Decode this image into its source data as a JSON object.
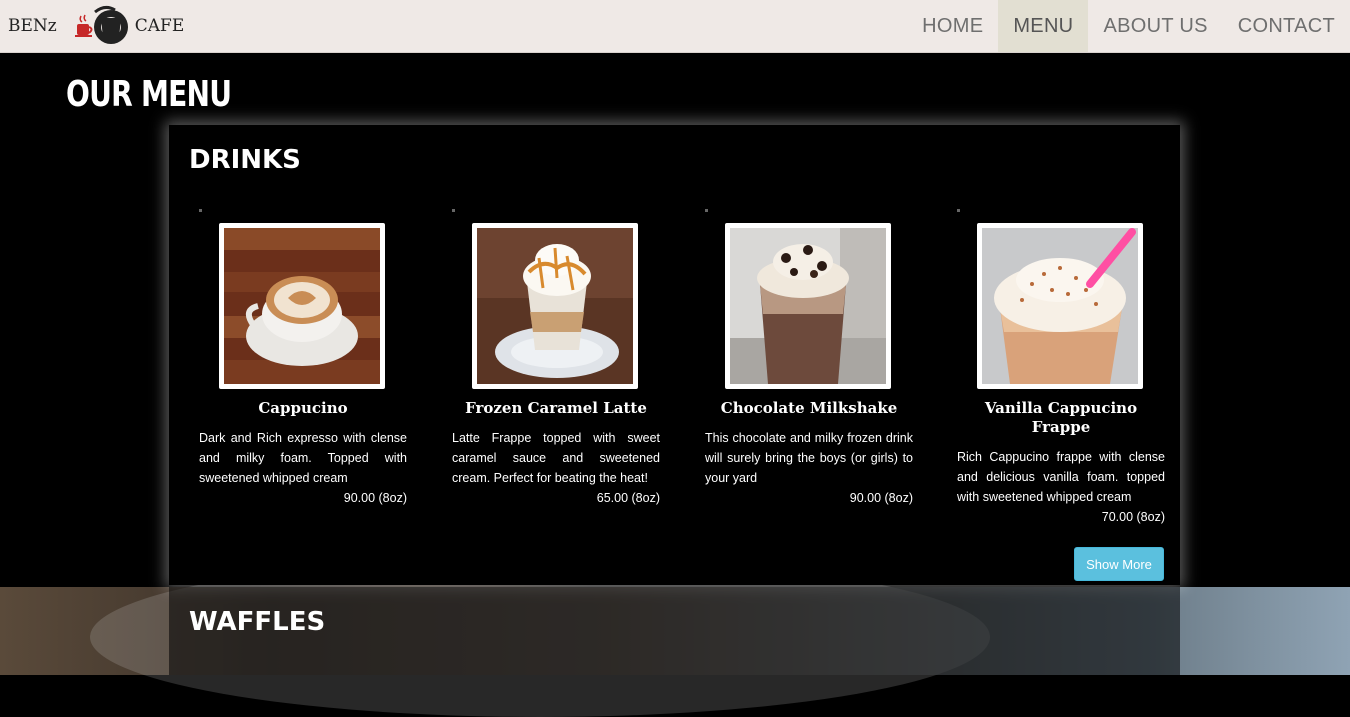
{
  "navbar": {
    "brand_left": "BENz",
    "brand_right": "CAFE",
    "links": [
      {
        "label": "HOME",
        "active": false
      },
      {
        "label": "MENU",
        "active": true
      },
      {
        "label": "ABOUT US",
        "active": false
      },
      {
        "label": "CONTACT",
        "active": false
      }
    ]
  },
  "page": {
    "title": "OUR MENU"
  },
  "drinks": {
    "title": "DRINKS",
    "items": [
      {
        "name": "Cappucino",
        "description": "Dark and Rich expresso with clense and milky foam. Topped with sweetened whipped cream",
        "price": "90.00 (8oz)"
      },
      {
        "name": "Frozen Caramel Latte",
        "description": "Latte Frappe topped with sweet caramel sauce and sweetened cream. Perfect for beating the heat!",
        "price": "65.00 (8oz)"
      },
      {
        "name": "Chocolate Milkshake",
        "description": "This chocolate and milky frozen drink will surely bring the boys (or girls) to your yard",
        "price": "90.00 (8oz)"
      },
      {
        "name": "Vanilla Cappucino Frappe",
        "description": "Rich Cappucino frappe with clense and delicious vanilla foam. topped with sweetened whipped cream",
        "price": "70.00 (8oz)"
      }
    ],
    "show_more_label": "Show More"
  },
  "waffles": {
    "title": "WAFFLES"
  },
  "colors": {
    "accent_button": "#5bc0de",
    "navbar_bg": "#efe9e6",
    "active_nav_bg": "#e2dfd2"
  }
}
